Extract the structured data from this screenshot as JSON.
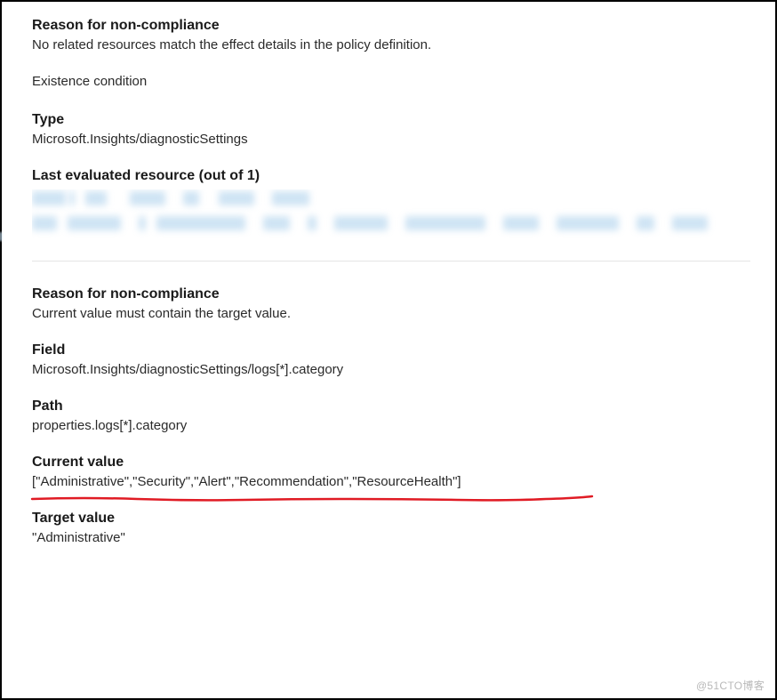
{
  "section1": {
    "heading": "Reason for non-compliance",
    "body": "No related resources match the effect details in the policy definition.",
    "condition": "Existence condition"
  },
  "type": {
    "heading": "Type",
    "value": "Microsoft.Insights/diagnosticSettings"
  },
  "lastEvaluated": {
    "heading": "Last evaluated resource (out of 1)"
  },
  "section2": {
    "heading": "Reason for non-compliance",
    "body": "Current value must contain the target value."
  },
  "field": {
    "heading": "Field",
    "value": "Microsoft.Insights/diagnosticSettings/logs[*].category"
  },
  "path": {
    "heading": "Path",
    "value": "properties.logs[*].category"
  },
  "currentValue": {
    "heading": "Current value",
    "value": "[\"Administrative\",\"Security\",\"Alert\",\"Recommendation\",\"ResourceHealth\"]"
  },
  "targetValue": {
    "heading": "Target value",
    "value": "\"Administrative\""
  },
  "watermark": "@51CTO博客"
}
